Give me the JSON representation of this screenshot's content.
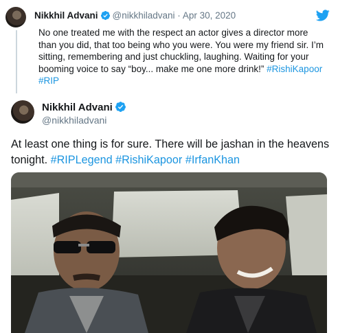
{
  "quoted_tweet": {
    "name": "Nikkhil Advani",
    "handle": "@nikkhiladvani",
    "separator": "·",
    "date": "Apr 30, 2020",
    "text": "No one treated me with the respect an actor gives a director more than you did, that too being who you were. You were my friend sir. I’m sitting, remembering and just chuckling, laughing. Waiting for your booming voice to say “boy... make me one more drink!”",
    "hashtags": [
      "#RishiKapoor",
      "#RIP"
    ]
  },
  "main_tweet": {
    "name": "Nikkhil Advani",
    "handle": "@nikkhiladvani",
    "text": "At least one thing is for sure. There will be jashan in the heavens tonight.",
    "hashtags": [
      "#RIPLegend",
      "#RishiKapoor",
      "#IrfanKhan"
    ]
  },
  "colors": {
    "link": "#1b95e0",
    "verified": "#1da1f2",
    "muted": "#657786",
    "text": "#14171a",
    "thread": "#ccd6dd"
  },
  "icons": [
    "verified-badge-icon",
    "twitter-bird-icon"
  ]
}
